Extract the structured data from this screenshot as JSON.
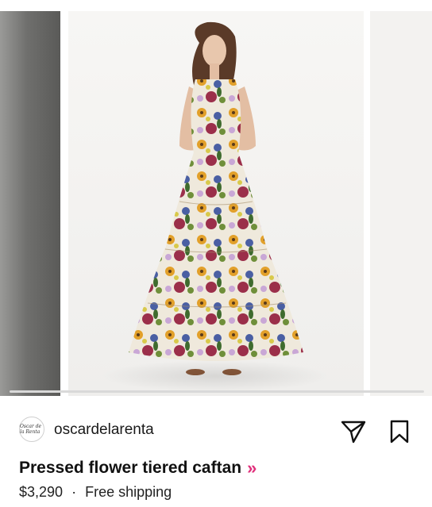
{
  "post": {
    "avatar_text": "Oscar de la Renta",
    "handle": "oscardelarenta",
    "share_icon": "send-paper-plane-icon",
    "save_icon": "bookmark-icon"
  },
  "product": {
    "title": "Pressed flower tiered caftan",
    "chevron": "»",
    "price": "$3,290",
    "separator": "·",
    "shipping": "Free shipping"
  },
  "carousel": {
    "progress_fraction": 0.0,
    "colors": {
      "chevron": "#e0317c"
    }
  }
}
